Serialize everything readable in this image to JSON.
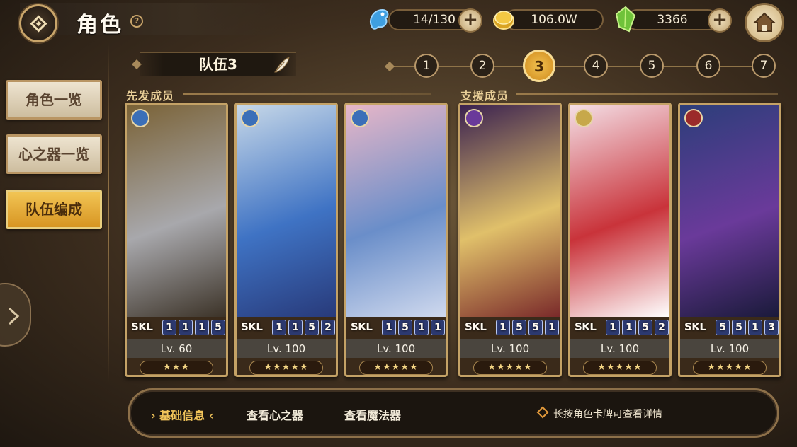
{
  "header": {
    "title": "角色",
    "help_symbol": "?"
  },
  "resources": {
    "stamina": {
      "icon": "blue-fish-icon",
      "value": "14/130"
    },
    "gold": {
      "icon": "gold-coin-icon",
      "value": "106.0W"
    },
    "gems": {
      "icon": "green-crystal-icon",
      "value": "3366"
    },
    "plus_symbol": "+"
  },
  "nav": {
    "items": [
      {
        "label": "角色一览",
        "active": false
      },
      {
        "label": "心之器一览",
        "active": false
      },
      {
        "label": "队伍编成",
        "active": true
      }
    ]
  },
  "team": {
    "name": "队伍3",
    "numbers": [
      "1",
      "2",
      "3",
      "4",
      "5",
      "6",
      "7"
    ],
    "active_index": 2
  },
  "sections": {
    "main_label": "先发成员",
    "support_label": "支援成员"
  },
  "cards": [
    {
      "element": "water",
      "element_color": "#3b6fb8",
      "skl_label": "SKL",
      "skills": [
        "1",
        "1",
        "1",
        "5"
      ],
      "level": "Lv. 60",
      "stars": "★★★",
      "art_colors": [
        "#7a6236",
        "#a8a8ac",
        "#3c3328"
      ]
    },
    {
      "element": "water",
      "element_color": "#3b6fb8",
      "skl_label": "SKL",
      "skills": [
        "1",
        "1",
        "5",
        "2"
      ],
      "level": "Lv. 100",
      "stars": "★★★★★",
      "art_colors": [
        "#c7d8e8",
        "#3f73c4",
        "#283a7a"
      ]
    },
    {
      "element": "water",
      "element_color": "#3b6fb8",
      "skl_label": "SKL",
      "skills": [
        "1",
        "5",
        "1",
        "1"
      ],
      "level": "Lv. 100",
      "stars": "★★★★★",
      "art_colors": [
        "#e7b6c8",
        "#6a8ec9",
        "#cfd9ee"
      ]
    },
    {
      "element": "dark",
      "element_color": "#6a3a9a",
      "skl_label": "SKL",
      "skills": [
        "1",
        "5",
        "5",
        "1"
      ],
      "level": "Lv. 100",
      "stars": "★★★★★",
      "art_colors": [
        "#3a2150",
        "#e0c06a",
        "#7a2a2a"
      ]
    },
    {
      "element": "light",
      "element_color": "#c7a84a",
      "skl_label": "SKL",
      "skills": [
        "1",
        "1",
        "5",
        "2"
      ],
      "level": "Lv. 100",
      "stars": "★★★★★",
      "art_colors": [
        "#f4dfe6",
        "#c9333a",
        "#ffffff"
      ]
    },
    {
      "element": "fire",
      "element_color": "#9b2a2a",
      "skl_label": "SKL",
      "skills": [
        "5",
        "5",
        "1",
        "3"
      ],
      "level": "Lv. 100",
      "stars": "★★★★★",
      "art_colors": [
        "#2c3e7a",
        "#6a3a9a",
        "#1a1a3a"
      ]
    }
  ],
  "bottom": {
    "tabs": [
      {
        "label": "基础信息",
        "active": true,
        "marker_left": "›",
        "marker_right": "‹"
      },
      {
        "label": "查看心之器",
        "active": false
      },
      {
        "label": "查看魔法器",
        "active": false
      }
    ],
    "hint": "长按角色卡牌可查看详情"
  }
}
